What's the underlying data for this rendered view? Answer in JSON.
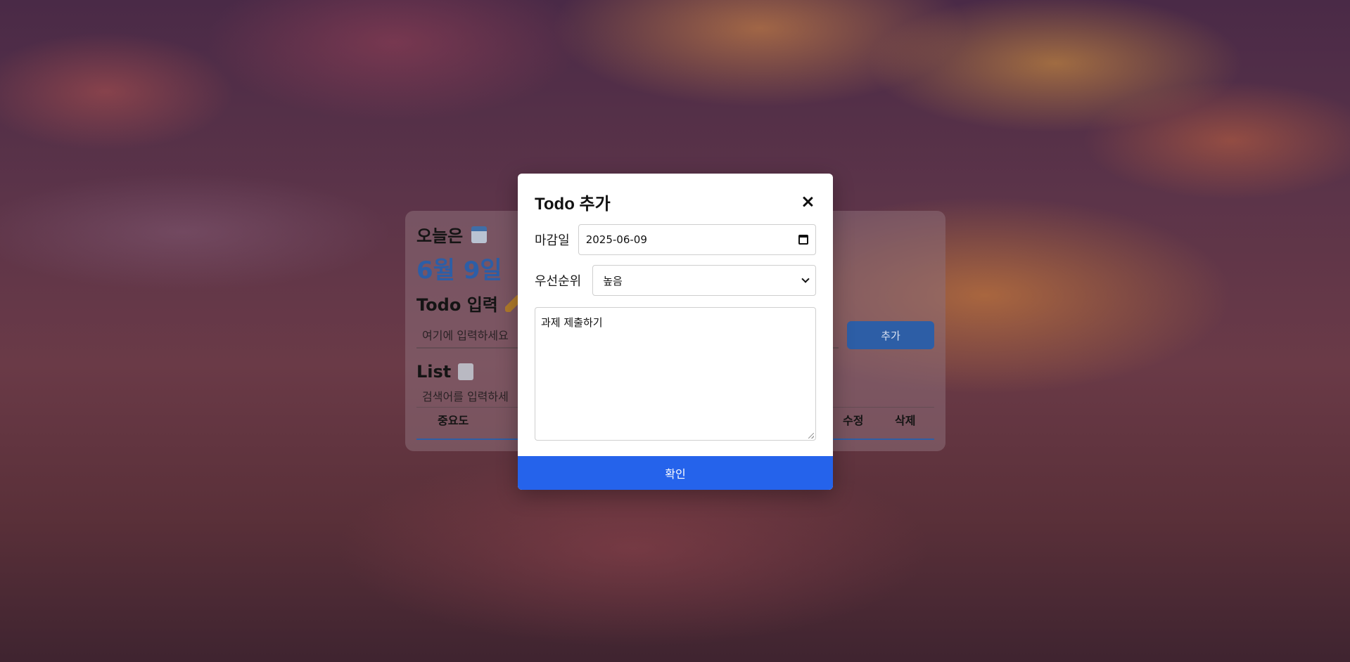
{
  "background": {
    "heading": "오늘은",
    "date": "6월 9일",
    "todo_input_title": "Todo 입력",
    "todo_input_placeholder": "여기에 입력하세요",
    "add_button": "추가",
    "list_title": "List",
    "search_placeholder": "검색어를 입력하세",
    "table_headers": {
      "priority": "중요도",
      "edit": "수정",
      "delete": "삭제"
    }
  },
  "modal": {
    "title": "Todo 추가",
    "due_label": "마감일",
    "due_value": "2025-06-09",
    "priority_label": "우선순위",
    "priority_value": "높음",
    "content_value": "과제 제출하기",
    "confirm_button": "확인"
  },
  "colors": {
    "accent": "#2563eb",
    "date_text": "#2d5ea6",
    "modal_bg": "#ffffff"
  },
  "icons": [
    "calendar-icon",
    "pencil-icon",
    "document-icon",
    "close-icon",
    "chevron-down-icon"
  ]
}
